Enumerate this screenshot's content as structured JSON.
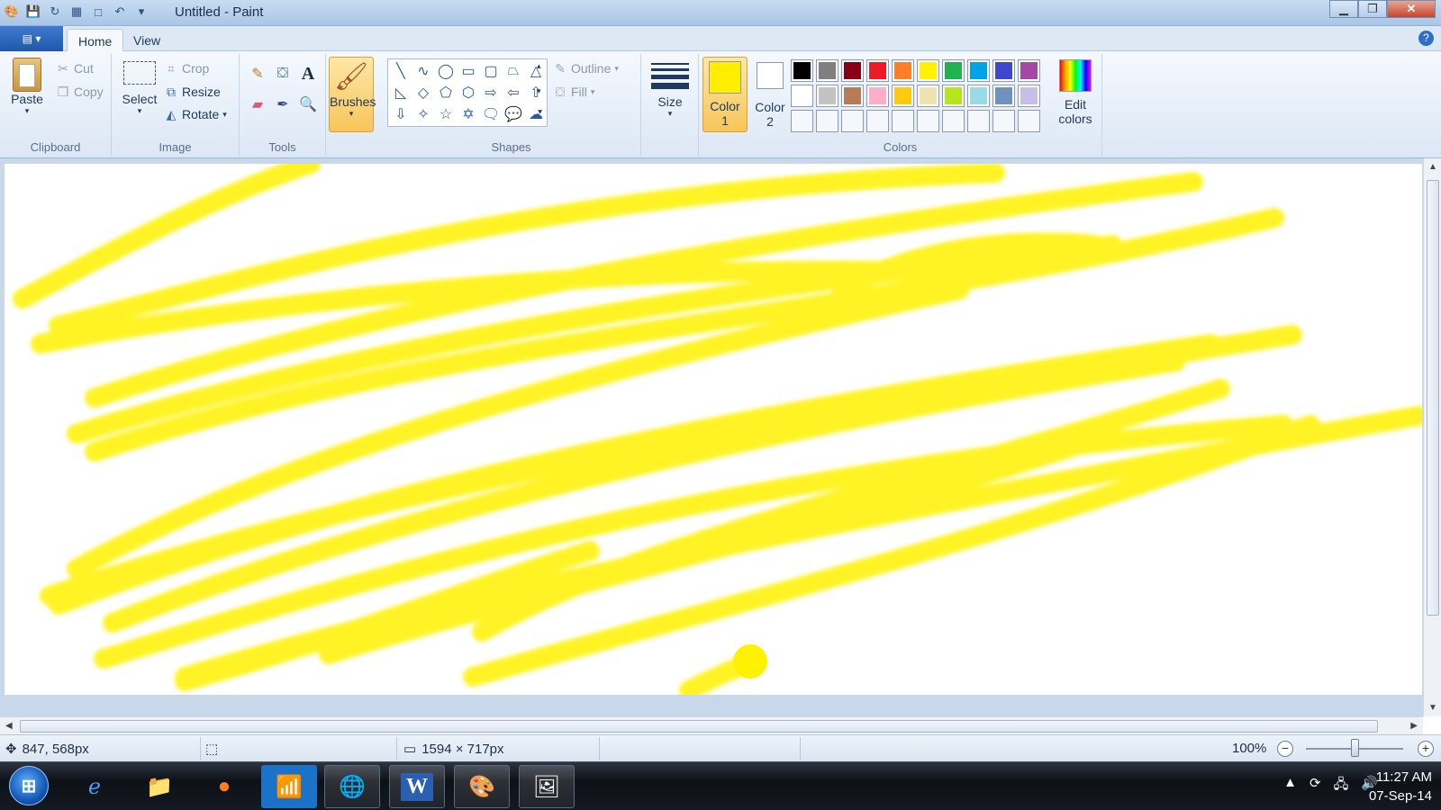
{
  "window": {
    "title": "Untitled - Paint"
  },
  "quick_access": {
    "icons": [
      "paint-app-icon",
      "save-icon",
      "redo-icon",
      "palette-icon",
      "new-icon",
      "undo-icon",
      "customize-icon"
    ]
  },
  "tabs": {
    "home": "Home",
    "view": "View"
  },
  "clipboard": {
    "paste": "Paste",
    "cut": "Cut",
    "copy": "Copy",
    "label": "Clipboard"
  },
  "image": {
    "select": "Select",
    "crop": "Crop",
    "resize": "Resize",
    "rotate": "Rotate",
    "label": "Image"
  },
  "tools": {
    "label": "Tools"
  },
  "brushes": {
    "label": "Brushes"
  },
  "shapes": {
    "outline": "Outline",
    "fill": "Fill",
    "label": "Shapes"
  },
  "size": {
    "label": "Size"
  },
  "colors": {
    "color1": "Color",
    "color1_num": "1",
    "color2": "Color",
    "color2_num": "2",
    "edit": "Edit",
    "edit2": "colors",
    "label": "Colors",
    "color1_value": "#ffee00",
    "color2_value": "#ffffff",
    "palette_row1": [
      "#000000",
      "#7f7f7f",
      "#880015",
      "#ed1c24",
      "#ff7f27",
      "#fff200",
      "#22b14c",
      "#00a2e8",
      "#3f48cc",
      "#a349a4"
    ],
    "palette_row2": [
      "#ffffff",
      "#c3c3c3",
      "#b97a57",
      "#ffaec9",
      "#ffc90e",
      "#efe4b0",
      "#b5e61d",
      "#99d9ea",
      "#7092be",
      "#c8bfe7"
    ]
  },
  "status": {
    "cursor": "847, 568px",
    "dimensions": "1594 × 717px",
    "zoom": "100%"
  },
  "tray": {
    "time": "11:27 AM",
    "date": "07-Sep-14"
  }
}
